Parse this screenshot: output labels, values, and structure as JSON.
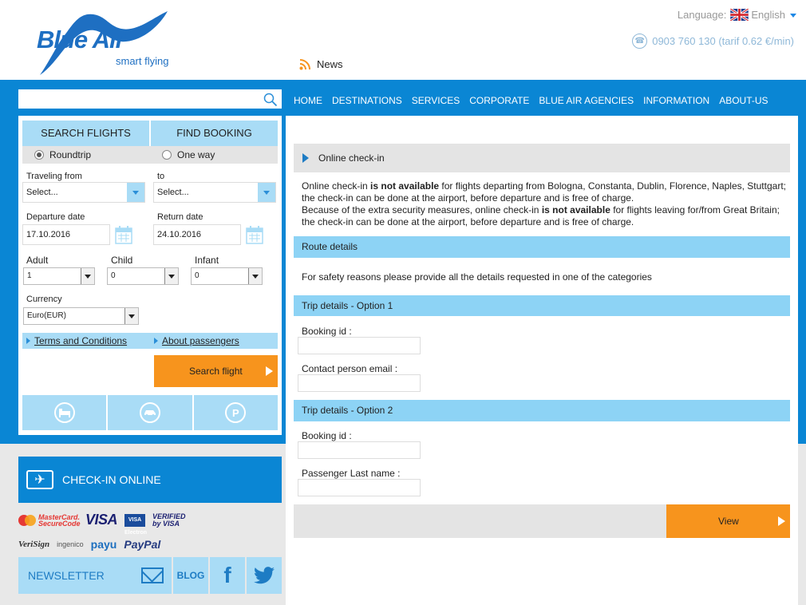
{
  "brand": {
    "name": "Blue Air",
    "tagline": "smart flying"
  },
  "header": {
    "language_label": "Language:",
    "language_value": "English",
    "phone": "0903 760 130 (tarif 0.62 €/min)",
    "news": "News"
  },
  "search": {
    "placeholder": ""
  },
  "nav": [
    "HOME",
    "DESTINATIONS",
    "SERVICES",
    "CORPORATE",
    "BLUE AIR AGENCIES",
    "INFORMATION",
    "ABOUT-US"
  ],
  "booking": {
    "tabs": [
      "SEARCH FLIGHTS",
      "FIND BOOKING"
    ],
    "trip_types": [
      "Roundtrip",
      "One way"
    ],
    "selected_trip": "Roundtrip",
    "from_label": "Traveling from",
    "to_label": "to",
    "from_value": "Select...",
    "to_value": "Select...",
    "departure_label": "Departure date",
    "return_label": "Return date",
    "departure_value": "17.10.2016",
    "return_value": "24.10.2016",
    "adult_label": "Adult",
    "child_label": "Child",
    "infant_label": "Infant",
    "adult_value": "1",
    "child_value": "0",
    "infant_value": "0",
    "currency_label": "Currency",
    "currency_value": "Euro(EUR)",
    "terms_link": "Terms and Conditions",
    "passengers_link": "About passengers",
    "search_button": "Search flight",
    "services": [
      "bed-icon",
      "car-icon",
      "parking-icon"
    ],
    "parking_glyph": "P"
  },
  "checkin_box": {
    "label": "CHECK-IN ONLINE"
  },
  "payments": {
    "mastercard": "MasterCard. SecureCode",
    "visa": "VISA",
    "visa_electron": "VISA Electron",
    "verified_visa": "VERIFIED by VISA",
    "verisign": "VeriSign",
    "ingenico": "ingenico",
    "payu": "payu",
    "paypal": "PayPal"
  },
  "footer_left": {
    "newsletter": "NEWSLETTER",
    "blog": "BLOG",
    "facebook": "f"
  },
  "main": {
    "title": "Online check-in",
    "notice": {
      "p1_a": "Online check-in ",
      "p1_b": "is not available",
      "p1_c": " for flights departing from Bologna, Constanta, Dublin, Florence, Naples, Stuttgart; the check-in can be done at the airport, before departure and is free of charge.",
      "p2_a": "Because of the extra security measures, online check-in ",
      "p2_b": "is not available",
      "p2_c": " for flights leaving for/from Great Britain; the check-in can be done at the airport, before departure and is free of charge."
    },
    "route_details": "Route details",
    "safety_info": "For safety reasons please provide all the details requested in one of the categories",
    "option1": "Trip details - Option 1",
    "option1_fields": [
      "Booking id :",
      "Contact person email :"
    ],
    "option2": "Trip details - Option 2",
    "option2_fields": [
      "Booking id :",
      "Passenger Last name :"
    ],
    "view_button": "View"
  },
  "colors": {
    "brand_blue": "#0a86d4",
    "light_blue": "#a9dcf6",
    "orange": "#f7941d",
    "gray": "#e4e4e4"
  }
}
